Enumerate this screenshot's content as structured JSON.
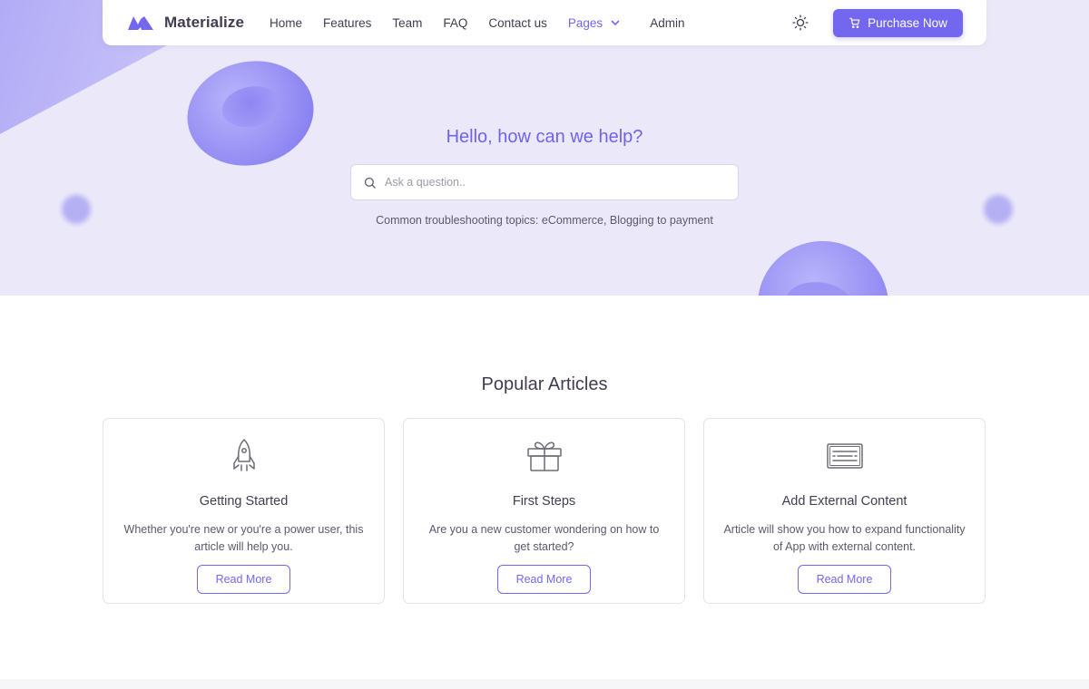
{
  "brand": {
    "name": "Materialize",
    "accent": "#7367f0"
  },
  "nav": {
    "links": [
      "Home",
      "Features",
      "Team",
      "FAQ",
      "Contact us"
    ],
    "pages_label": "Pages",
    "admin_label": "Admin",
    "theme_icon": "sun-icon",
    "purchase_label": "Purchase Now"
  },
  "hero": {
    "title": "Hello, how can we help?",
    "search_placeholder": "Ask a question..",
    "subtitle": "Common troubleshooting topics: eCommerce, Blogging to payment",
    "background": "#ebe9f9"
  },
  "articles": {
    "title": "Popular Articles",
    "items": [
      {
        "icon": "rocket-icon",
        "title": "Getting Started",
        "text": "Whether you're new or you're a power user, this article will help you.",
        "button": "Read More"
      },
      {
        "icon": "gift-icon",
        "title": "First Steps",
        "text": "Are you a new customer wondering on how to get started?",
        "button": "Read More"
      },
      {
        "icon": "keyboard-icon",
        "title": "Add External Content",
        "text": "Article will show you how to expand functionality of App with external content.",
        "button": "Read More"
      }
    ]
  }
}
